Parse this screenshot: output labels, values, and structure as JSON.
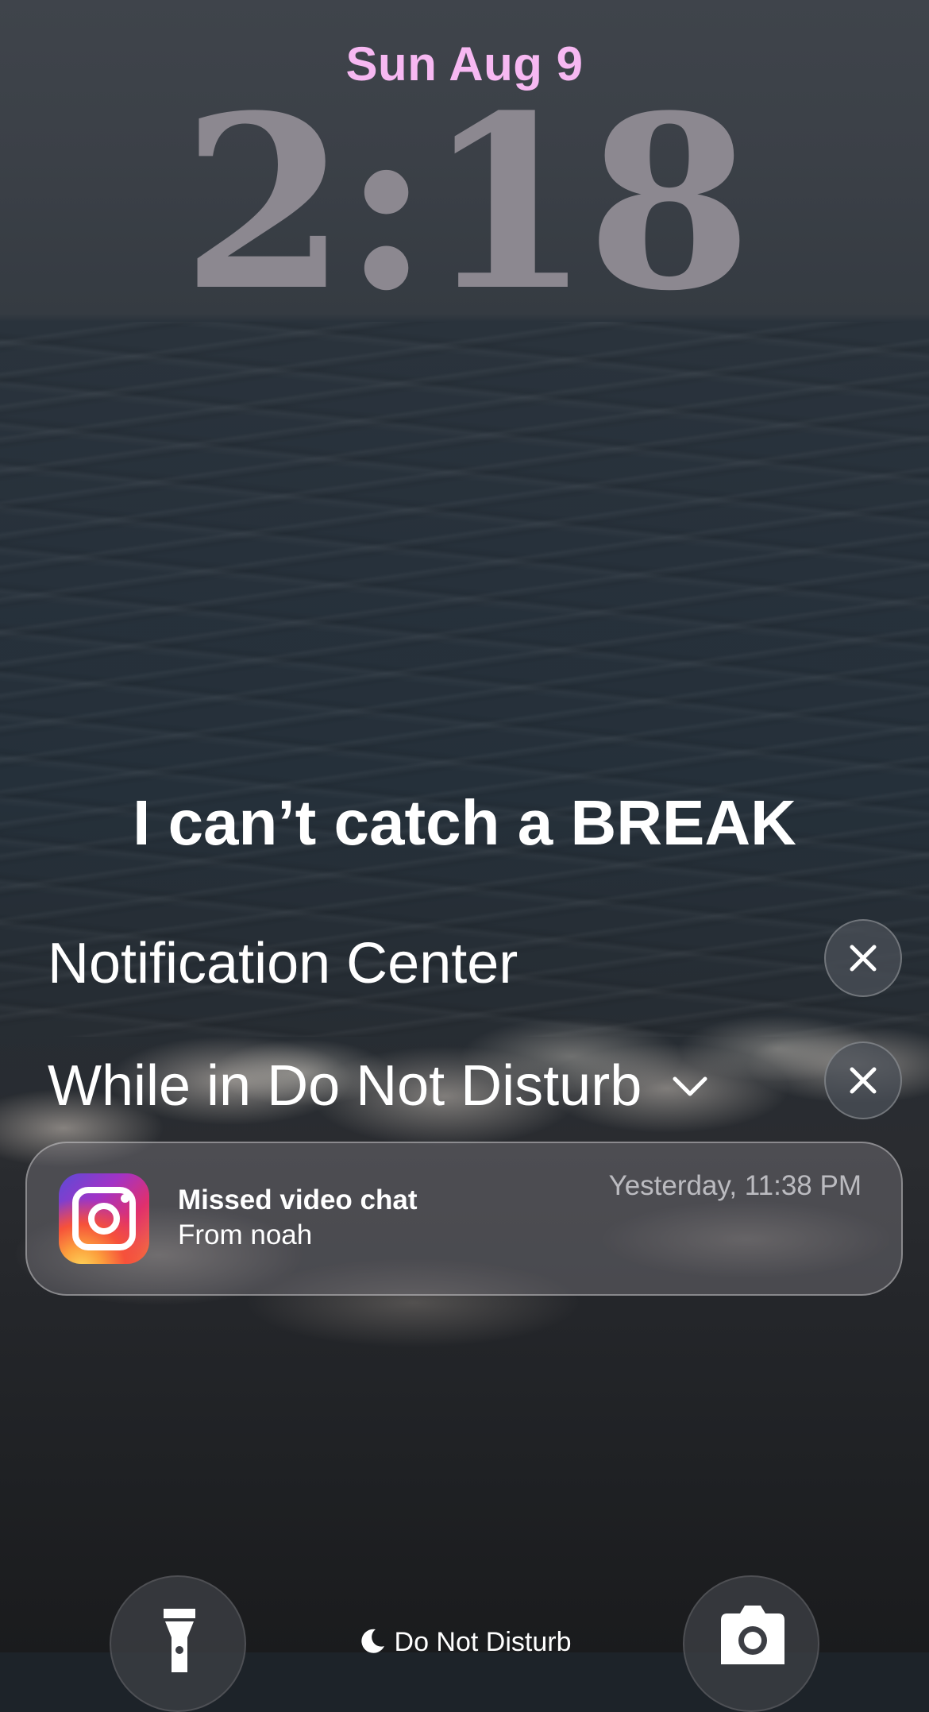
{
  "lock_screen": {
    "date": "Sun Aug 9",
    "time": "2:18",
    "widget_text": "I can’t catch a BREAK"
  },
  "notification_center": {
    "title": "Notification Center",
    "dnd_group_title": "While in Do Not Disturb",
    "notifications": [
      {
        "app_icon": "instagram-icon",
        "title": "Missed video chat",
        "body": "From noah",
        "time": "Yesterday, 11:38 PM"
      }
    ]
  },
  "bottom_bar": {
    "left_button_icon": "flashlight-icon",
    "right_button_icon": "camera-icon",
    "focus_mode_icon": "moon-icon",
    "focus_mode_label": "Do Not Disturb"
  },
  "colors": {
    "date_color": "#f7b8f2",
    "clock_color": "#8c8890"
  }
}
